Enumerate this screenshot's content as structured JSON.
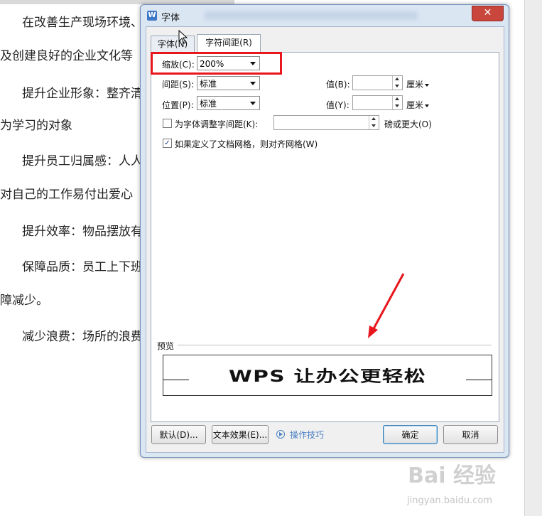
{
  "document": {
    "paragraphs": [
      "在改善生产现场环境、",
      "及创建良好的企业文化等",
      "提升企业形象：整齐清",
      "为学习的对象",
      "提升员工归属感：人人",
      "对自己的工作易付出爱心",
      "提升效率：物品摆放有",
      "保障品质：员工上下班",
      "障减少。",
      "减少浪费：场所的浪费"
    ],
    "watermark": "Bai 经验",
    "watermark_sub": "jingyan.baidu.com"
  },
  "dialog": {
    "title": "字体",
    "app_icon": "W",
    "close_label": "✕",
    "tabs": [
      "字体(N)",
      "字符间距(R)"
    ],
    "active_tab": "字符间距(R)",
    "scale": {
      "label": "缩放(C):",
      "value": "200%"
    },
    "spacing": {
      "label": "间距(S):",
      "value": "标准",
      "value_label": "值(B):",
      "unit": "厘米"
    },
    "position": {
      "label": "位置(P):",
      "value": "标准",
      "value_label": "值(Y):",
      "unit": "厘米"
    },
    "kerning": {
      "label": "为字体调整字间距(K):",
      "checked": false,
      "suffix": "磅或更大(O)"
    },
    "snap_grid": {
      "label": "如果定义了文档网格，则对齐网格(W)",
      "checked": true
    },
    "preview": {
      "label": "预览",
      "text": "WPS 让办公更轻松"
    },
    "buttons": {
      "default": "默认(D)...",
      "text_effect": "文本效果(E)...",
      "tips": "操作技巧",
      "ok": "确定",
      "cancel": "取消"
    }
  },
  "colors": {
    "annotation_red": "#e8161d",
    "tips_blue": "#4b7fc4",
    "close_red": "#c9463d"
  }
}
